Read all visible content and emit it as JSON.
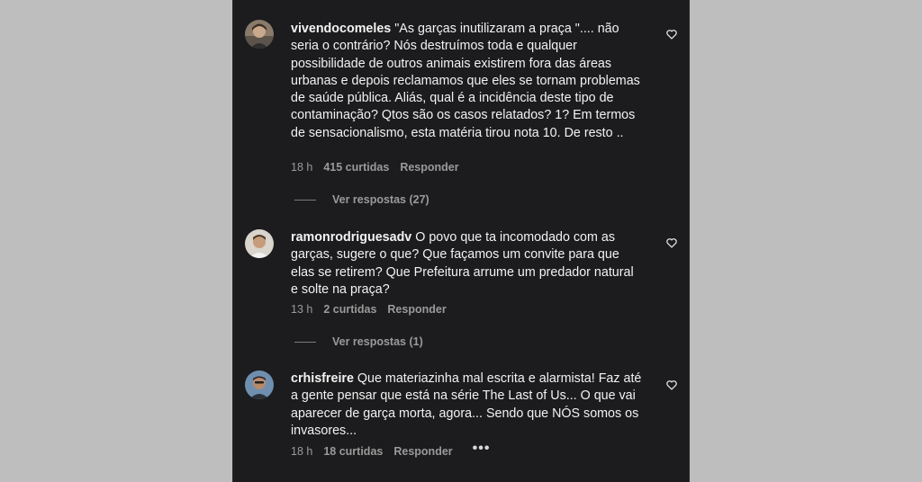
{
  "comments": [
    {
      "username": "vivendocomeles",
      "text": "\"As garças inutilizaram a praça \".... não seria o contrário? Nós destruímos toda e qualquer possibilidade de outros animais existirem fora das áreas urbanas e depois reclamamos que eles se tornam problemas de saúde pública. Aliás, qual é a incidência deste tipo de contaminação? Qtos são os casos relatados? 1? Em termos de sensacionalismo, esta matéria tirou nota 10. De resto ..",
      "time": "18 h",
      "likes": "415 curtidas",
      "reply_label": "Responder",
      "view_replies": "Ver respostas (27)",
      "avatar_icon": "user-avatar-photo",
      "like_icon": "heart-outline-icon"
    },
    {
      "username": "ramonrodriguesadv",
      "text": "O povo que ta incomodado com as garças, sugere o que? Que façamos um convite para que elas se retirem? Que Prefeitura arrume um predador natural e solte na praça?",
      "time": "13 h",
      "likes": "2 curtidas",
      "reply_label": "Responder",
      "view_replies": "Ver respostas (1)",
      "avatar_icon": "user-avatar-photo",
      "like_icon": "heart-outline-icon"
    },
    {
      "username": "crhisfreire",
      "text": "Que materiazinha mal escrita e alarmista! Faz até a gente pensar que está na série The Last of Us... O que vai aparecer de garça morta, agora... Sendo que NÓS somos os invasores...",
      "time": "18 h",
      "likes": "18 curtidas",
      "reply_label": "Responder",
      "more_label": "•••",
      "avatar_icon": "user-avatar-photo",
      "like_icon": "heart-outline-icon"
    }
  ],
  "colors": {
    "background": "#bebebe",
    "panel": "#1c1c1e",
    "text_primary": "#f2f2f2",
    "text_secondary": "#9a9a9a"
  }
}
